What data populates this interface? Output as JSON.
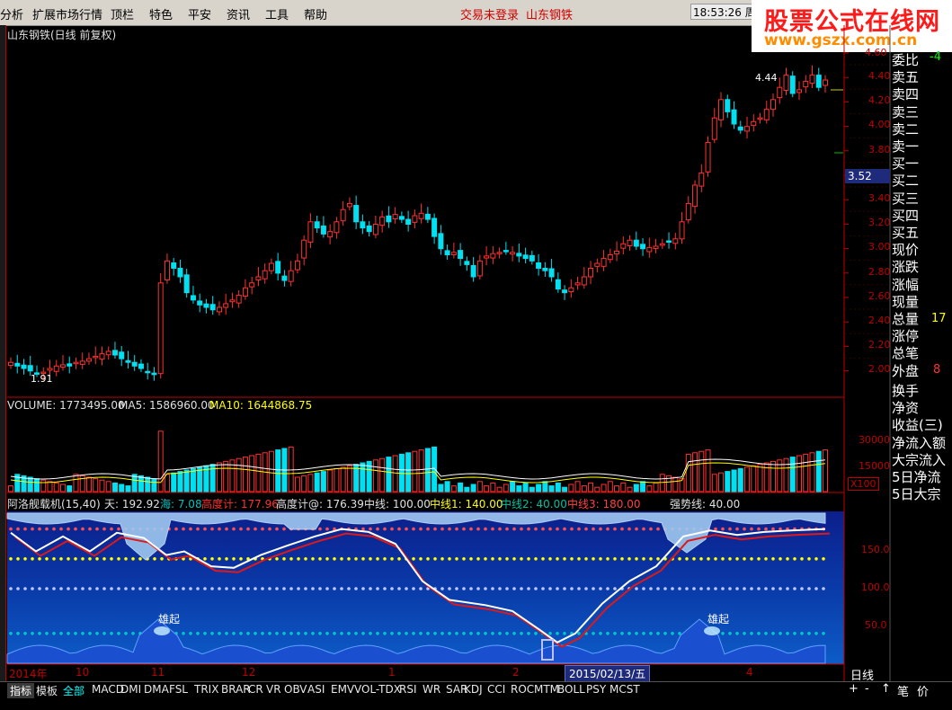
{
  "menu": {
    "items": [
      "分析",
      "扩展市场行情",
      "顶栏",
      "特色",
      "平安",
      "资讯",
      "工具",
      "帮助"
    ],
    "login_status": "交易未登录",
    "stock_name": "山东钢铁",
    "clock": "18:53:26 周五"
  },
  "logo": {
    "title": "股票公式在线网",
    "url": "www.gszx.com.cn"
  },
  "chart_title": "山东钢铁(日线 前复权)",
  "price_axis": [
    "4.40",
    "4.20",
    "4.00",
    "3.80",
    "3.60",
    "3.40",
    "3.20",
    "3.00",
    "2.80",
    "2.60",
    "2.40",
    "2.20",
    "2.00"
  ],
  "price_axis_top": "4.60",
  "current_price": "3.52",
  "high_label": "4.44",
  "low_label": "1.91",
  "volume": {
    "label": "VOLUME: 1773495.00",
    "ma5": "MA5: 1586960.00",
    "ma10": "MA10: 1644868.75",
    "axis": [
      "30000",
      "15000"
    ],
    "unit": "X100"
  },
  "indicator": {
    "name": "阿洛舰载机(15,40)",
    "tian": "天: 192.92",
    "hai": "海: 7.08",
    "gaodu": "高度计: 177.96",
    "gaodu_at": "高度计@: 176.39",
    "zhongxian": "中线: 100.00",
    "zx1": "中线1: 140.00",
    "zx2": "中线2: 40.00",
    "zx3": "中线3: 180.00",
    "qiangshi": "强势线: 40.00",
    "axis": [
      "150.0",
      "100.0",
      "50.0"
    ],
    "label_rise": "雄起"
  },
  "time_axis": [
    "2014年",
    "10",
    "11",
    "12",
    "1",
    "2",
    "3",
    "4"
  ],
  "cursor_date": "2015/02/13/五",
  "period_button": "日线",
  "side_panel": [
    "委比",
    "卖五",
    "卖四",
    "卖三",
    "卖二",
    "卖一",
    "买一",
    "买二",
    "买三",
    "买四",
    "买五",
    "现价",
    "涨跌",
    "涨幅",
    "现量",
    "总量",
    "涨停",
    "总笔",
    "外盘",
    "换手",
    "净资",
    "收益(三)",
    "净流入额",
    "大宗流入",
    "5日净流",
    "5日大宗"
  ],
  "side_values": {
    "weibi": "-4",
    "zongliang": "17",
    "waipan": "8"
  },
  "tabs": [
    "指标",
    "模板",
    "全部",
    "MACD",
    "DMI",
    "DMA",
    "FSL",
    "TRIX",
    "BRAR",
    "CR",
    "VR",
    "OBV",
    "ASI",
    "EMV",
    "VOL-TDX",
    "RSI",
    "WR",
    "SAR",
    "KDJ",
    "CCI",
    "ROC",
    "MTM",
    "BOLL",
    "PSY",
    "MCST"
  ],
  "right_buttons": [
    "+",
    "-",
    "↑",
    "笔",
    "价"
  ],
  "colors": {
    "up": "#ff3232",
    "down": "#00e0f0",
    "axis": "#c00000",
    "ind_bg": "#0a2a9a"
  }
}
